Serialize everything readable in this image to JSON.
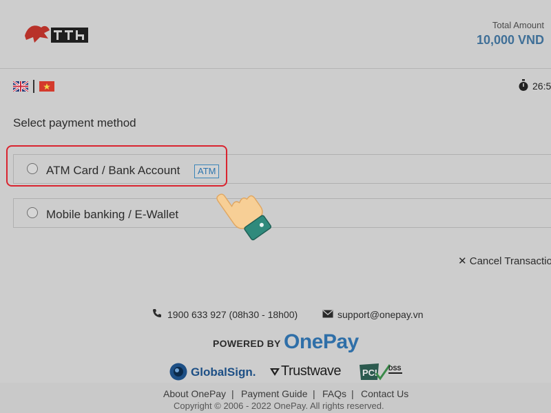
{
  "header": {
    "total_label": "Total Amount",
    "total_value": "10,000 VND"
  },
  "languages": [
    "english-flag-icon",
    "vietnam-flag-icon"
  ],
  "timer": {
    "icon": "stopwatch-icon",
    "text": "26:5"
  },
  "payment": {
    "title": "Select payment method",
    "options": [
      {
        "label": "ATM Card / Bank Account",
        "badge": "ATM"
      },
      {
        "label": "Mobile banking / E-Wallet"
      }
    ]
  },
  "cancel_label": "Cancel Transactio",
  "support": {
    "phone": "1900 633 927 (08h30 - 18h00)",
    "email": "support@onepay.vn"
  },
  "branding": {
    "powered_by": "POWERED BY",
    "brand": "OnePay",
    "globalsign": "GlobalSign.",
    "trustwave": "Trustwave",
    "pci": "PCI DSS"
  },
  "footer": {
    "links": [
      "About OnePay",
      "Payment Guide",
      "FAQs",
      "Contact Us"
    ],
    "copyright": "Copyright © 2006 - 2022 OnePay. All rights reserved."
  },
  "colors": {
    "accent": "#3f6f97",
    "highlight": "#d9232e",
    "background": "#cdcdcd"
  }
}
